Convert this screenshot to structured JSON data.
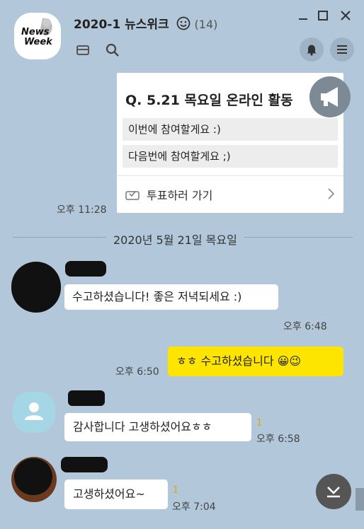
{
  "header": {
    "title": "2020-1 뉴스위크",
    "member_count": "(14)",
    "avatar_text_line1": "News",
    "avatar_text_line2": "Week"
  },
  "poll": {
    "question": "Q. 5.21 목요일 온라인 활동",
    "options": [
      "이번에 참여할게요 :)",
      "다음번에 참여할게요 ;)"
    ],
    "action_label": "투표하러 가기",
    "time": "오후 11:28"
  },
  "date_divider": "2020년 5월 21일 목요일",
  "messages": [
    {
      "text": "수고하셨습니다! 좋은 저녁되세요 :)",
      "time": "오후 6:48",
      "unread": ""
    },
    {
      "text": "ㅎㅎ 수고하셨습니다 😀😉",
      "time": "오후 6:50",
      "unread": ""
    },
    {
      "text": "감사합니다 고생하셨어요ㅎㅎ",
      "time": "오후 6:58",
      "unread": "1"
    },
    {
      "text": "고생하셨어요~",
      "time": "오후 7:04",
      "unread": "1"
    }
  ],
  "colors": {
    "background": "#b2c7da",
    "my_bubble": "#fee500",
    "unread": "#e0a800"
  }
}
